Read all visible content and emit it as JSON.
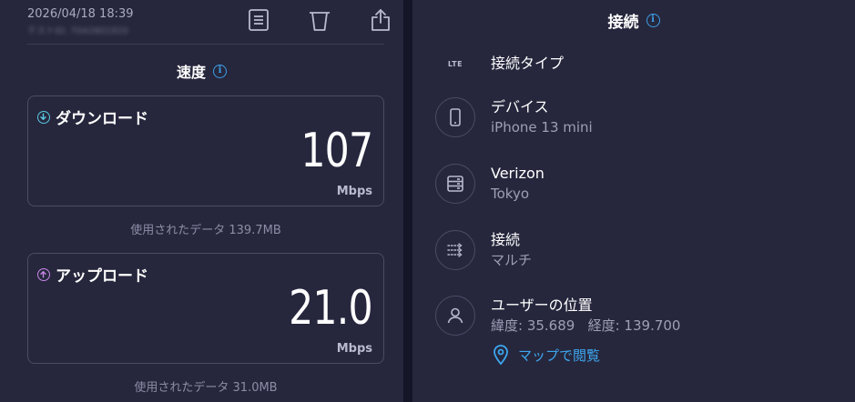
{
  "header": {
    "timestamp": "2026/04/18 18:39",
    "test_id": "テストID: 7042801920",
    "icons": [
      "results-list-icon",
      "trash-icon",
      "share-icon"
    ]
  },
  "speed": {
    "title": "速度",
    "download": {
      "label": "ダウンロード",
      "value": "107",
      "unit": "Mbps",
      "data_used": "使用されたデータ 139.7MB",
      "icon": "download-arrow-icon",
      "accent": "#5ac8e0"
    },
    "upload": {
      "label": "アップロード",
      "value": "21.0",
      "unit": "Mbps",
      "data_used": "使用されたデータ 31.0MB",
      "icon": "upload-arrow-icon",
      "accent": "#c887e6"
    }
  },
  "connection": {
    "title": "接続",
    "type": {
      "label": "接続タイプ",
      "badge": "LTE"
    },
    "device": {
      "label": "デバイス",
      "value": "iPhone 13 mini"
    },
    "provider": {
      "label": "Verizon",
      "value": "Tokyo"
    },
    "mode": {
      "label": "接続",
      "value": "マルチ"
    },
    "location": {
      "label": "ユーザーの位置",
      "value": "緯度: 35.689   経度: 139.700",
      "map_link": "マップで閲覧"
    }
  },
  "colors": {
    "background": "#26273d",
    "link": "#3da7ef",
    "info": "#3d9ee6"
  }
}
